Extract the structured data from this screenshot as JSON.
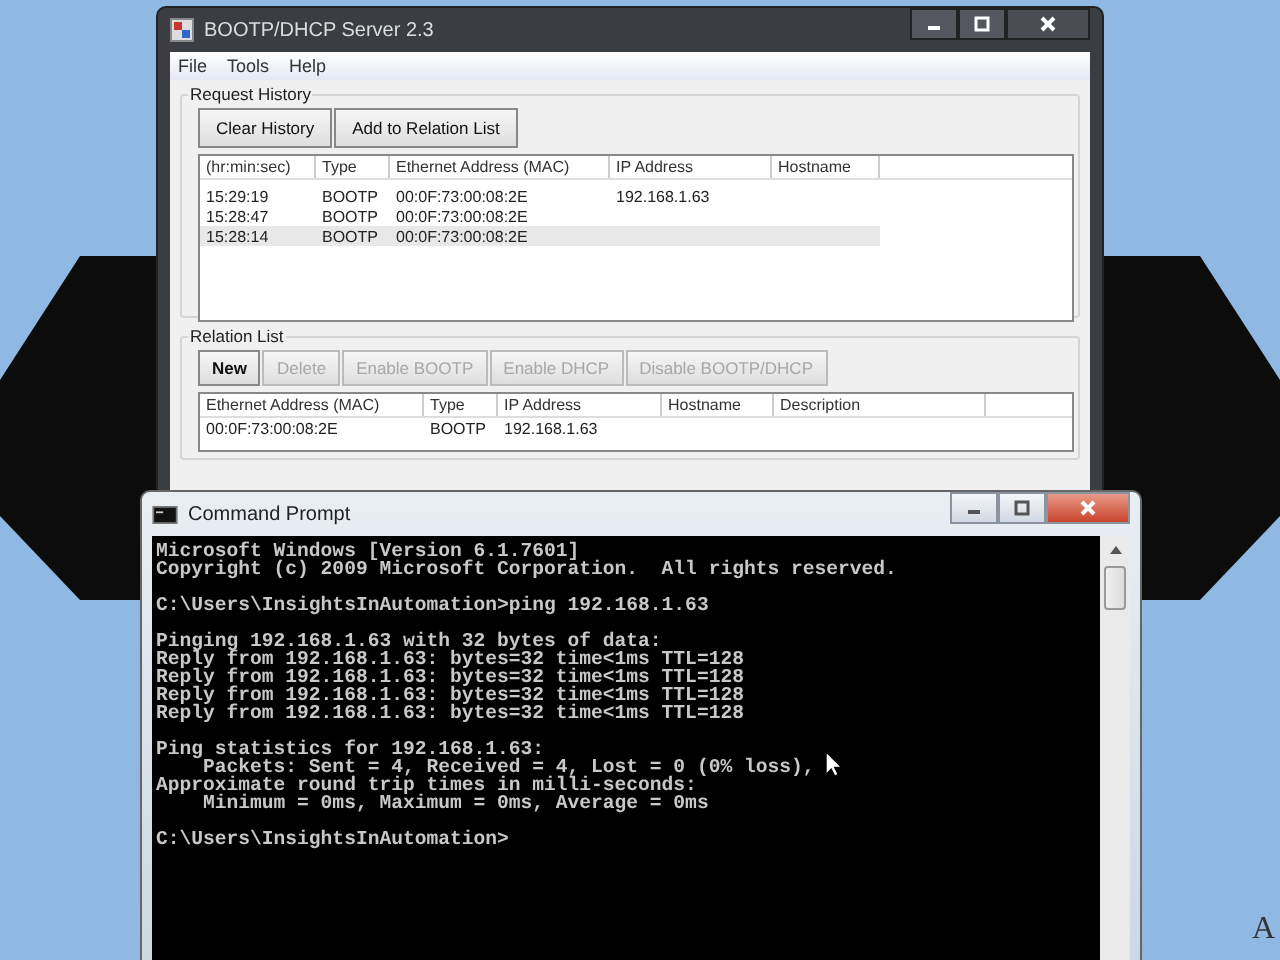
{
  "bootp_window": {
    "title": "BOOTP/DHCP Server 2.3",
    "menu": [
      "File",
      "Tools",
      "Help"
    ],
    "request_history": {
      "label": "Request History",
      "buttons": [
        {
          "label": "Clear History",
          "disabled": false
        },
        {
          "label": "Add to Relation List",
          "disabled": false
        }
      ],
      "columns": [
        "(hr:min:sec)",
        "Type",
        "Ethernet Address (MAC)",
        "IP Address",
        "Hostname"
      ],
      "rows": [
        {
          "cells": [
            "15:29:19",
            "BOOTP",
            "00:0F:73:00:08:2E",
            "192.168.1.63",
            ""
          ],
          "selected": false
        },
        {
          "cells": [
            "15:28:47",
            "BOOTP",
            "00:0F:73:00:08:2E",
            "",
            ""
          ],
          "selected": false
        },
        {
          "cells": [
            "15:28:14",
            "BOOTP",
            "00:0F:73:00:08:2E",
            "",
            ""
          ],
          "selected": true
        }
      ]
    },
    "relation_list": {
      "label": "Relation List",
      "buttons": [
        {
          "label": "New",
          "disabled": false
        },
        {
          "label": "Delete",
          "disabled": true
        },
        {
          "label": "Enable BOOTP",
          "disabled": true
        },
        {
          "label": "Enable DHCP",
          "disabled": true
        },
        {
          "label": "Disable BOOTP/DHCP",
          "disabled": true
        }
      ],
      "columns": [
        "Ethernet Address (MAC)",
        "Type",
        "IP Address",
        "Hostname",
        "Description"
      ],
      "rows": [
        {
          "cells": [
            "00:0F:73:00:08:2E",
            "BOOTP",
            "192.168.1.63",
            "",
            ""
          ],
          "selected": false
        }
      ]
    }
  },
  "cmd_window": {
    "title": "Command Prompt",
    "blocks": [
      [
        "Microsoft Windows [Version 6.1.7601]",
        "Copyright (c) 2009 Microsoft Corporation.  All rights reserved."
      ],
      [
        "C:\\Users\\InsightsInAutomation>ping 192.168.1.63"
      ],
      [
        "Pinging 192.168.1.63 with 32 bytes of data:",
        "Reply from 192.168.1.63: bytes=32 time<1ms TTL=128",
        "Reply from 192.168.1.63: bytes=32 time<1ms TTL=128",
        "Reply from 192.168.1.63: bytes=32 time<1ms TTL=128",
        "Reply from 192.168.1.63: bytes=32 time<1ms TTL=128"
      ],
      [
        "Ping statistics for 192.168.1.63:",
        "    Packets: Sent = 4, Received = 4, Lost = 0 (0% loss),",
        "Approximate round trip times in milli-seconds:",
        "    Minimum = 0ms, Maximum = 0ms, Average = 0ms"
      ],
      [
        "C:\\Users\\InsightsInAutomation>"
      ]
    ]
  },
  "desktop_text": "A"
}
